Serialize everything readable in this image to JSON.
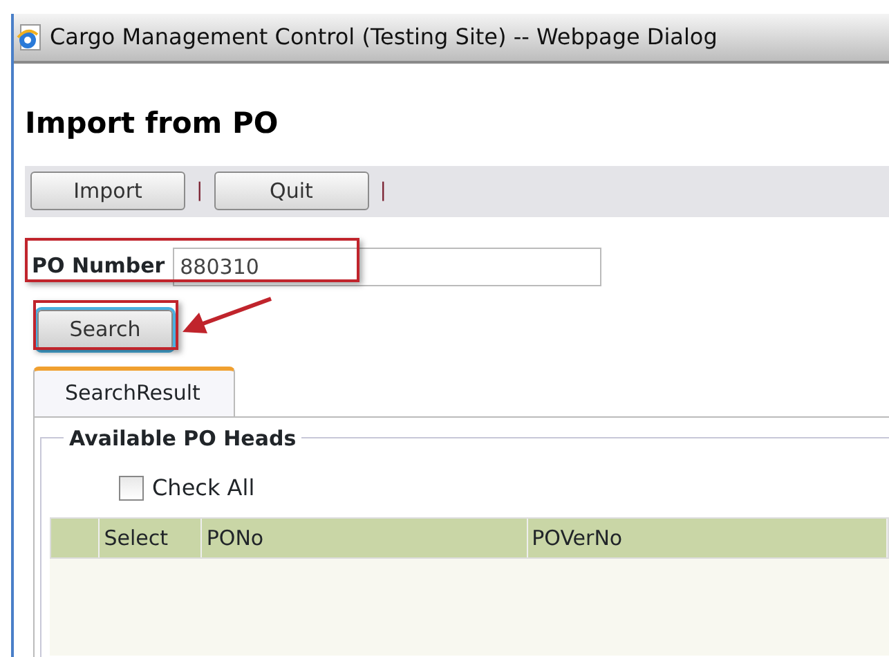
{
  "window": {
    "title": "Cargo Management Control (Testing Site) -- Webpage Dialog"
  },
  "heading": "Import from PO",
  "toolbar": [
    {
      "kind": "button",
      "label": "Import"
    },
    {
      "kind": "separator",
      "label": "|"
    },
    {
      "kind": "button",
      "label": "Quit"
    },
    {
      "kind": "separator",
      "label": "|"
    }
  ],
  "po_number": {
    "label": "PO Number",
    "value": "880310"
  },
  "search_button": {
    "label": "Search",
    "focused": true
  },
  "tabs": [
    {
      "label": "SearchResult",
      "selected": true
    }
  ],
  "group": {
    "legend": "Available PO Heads",
    "check_all": {
      "label": "Check All",
      "checked": false
    },
    "table": {
      "columns": [
        "",
        "Select",
        "PONo",
        "POVerNo"
      ]
    }
  }
}
